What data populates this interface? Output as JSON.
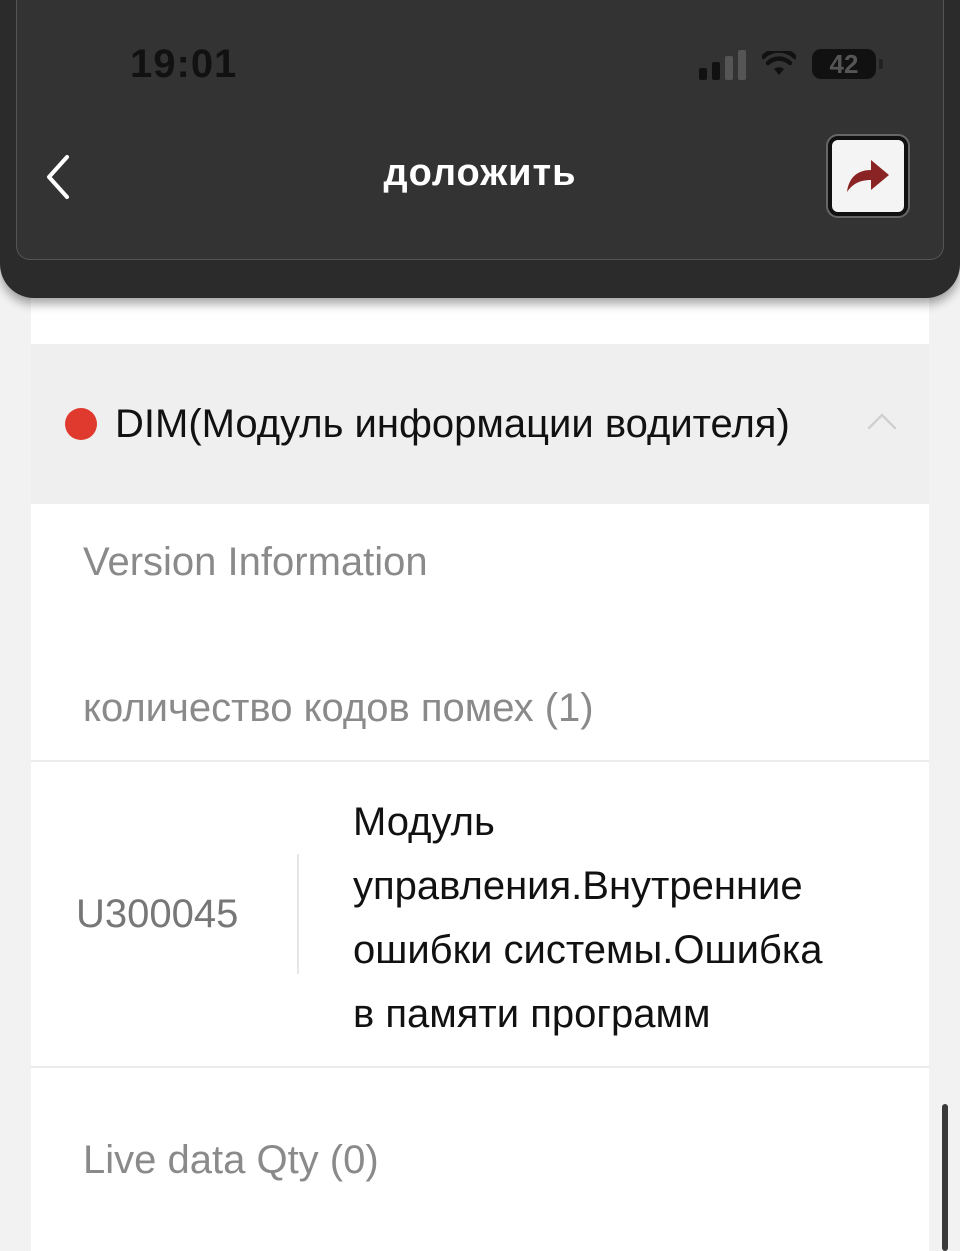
{
  "status_bar": {
    "time": "19:01",
    "battery": "42"
  },
  "header": {
    "title": "доложить",
    "back_icon": "chevron-left-icon",
    "share_icon": "share-arrow-icon"
  },
  "module": {
    "status_color": "#e03a2e",
    "title": "DIM(Модуль информации водителя)",
    "expanded": true
  },
  "sections": {
    "version_info": "Version Information",
    "dtc_count": "количество кодов помех (1)",
    "live_data": "Live data Qty (0)"
  },
  "dtcs": [
    {
      "code": "U300045",
      "description_lines": [
        "Модуль",
        "управления.Внутренние",
        "ошибки системы.Ошибка",
        "в памяти программ"
      ]
    }
  ]
}
